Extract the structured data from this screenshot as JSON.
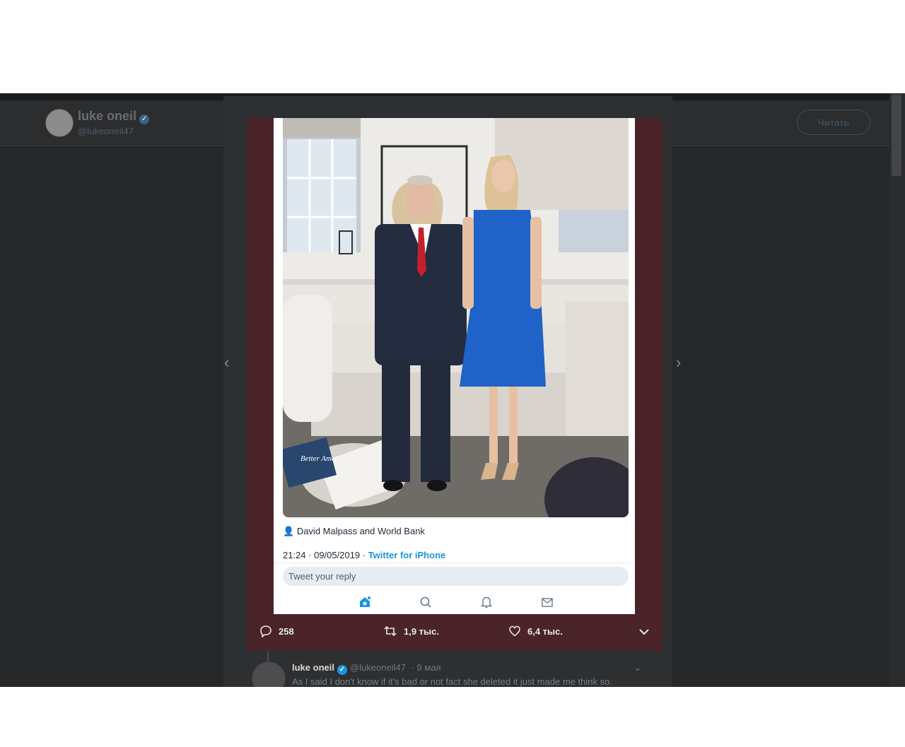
{
  "profile": {
    "name": "luke oneil",
    "handle": "@lukeoneil47",
    "follow_label": "Читать"
  },
  "media": {
    "tagged_people": "David Malpass and World Bank",
    "timestamp": "21:24 · 09/05/2019 · ",
    "via": "Twitter for iPhone",
    "reply_placeholder": "Tweet your reply",
    "book_text": "Better Ame"
  },
  "actions": {
    "replies": "258",
    "retweets": "1,9 тыс.",
    "likes": "6,4 тыс."
  },
  "reply_tweet": {
    "name": "luke oneil",
    "handle": "@lukeoneil47",
    "date": "· 9 мая",
    "text": "As I said I don't know if it's bad or not fact she deleted it just made me think so."
  },
  "colors": {
    "accent": "#1b95e0",
    "media_bg": "#4a2429",
    "overlay": "#262728",
    "dress": "#1f63c8",
    "tie": "#c3202e"
  }
}
